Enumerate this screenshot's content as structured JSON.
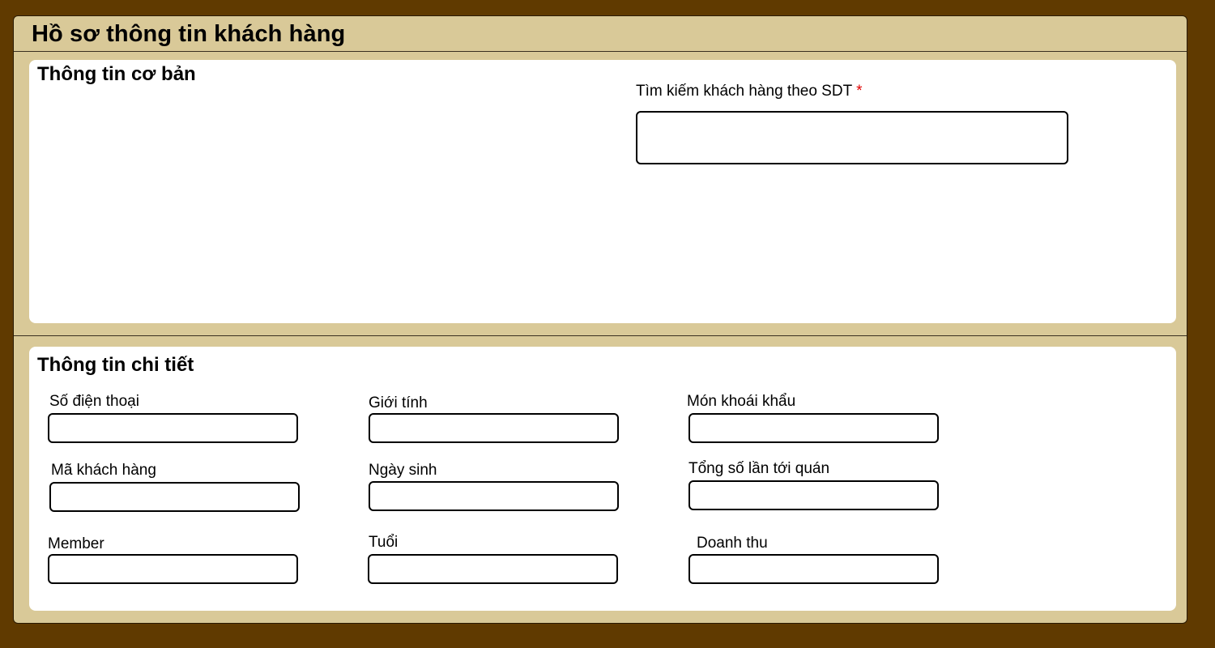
{
  "window": {
    "title": "Hồ sơ thông tin khách hàng"
  },
  "basic_info": {
    "title": "Thông tin cơ bản",
    "search": {
      "label": "Tìm kiếm khách hàng theo SDT",
      "required_mark": "*",
      "value": "",
      "placeholder": ""
    }
  },
  "detail_info": {
    "title": "Thông tin chi tiết",
    "fields": {
      "phone": {
        "label": "Số điện thoại",
        "value": ""
      },
      "gender": {
        "label": "Giới tính",
        "value": ""
      },
      "favorite_dish": {
        "label": "Món khoái khẩu",
        "value": ""
      },
      "customer_code": {
        "label": "Mã khách hàng",
        "value": ""
      },
      "birthday": {
        "label": "Ngày sinh",
        "value": ""
      },
      "visit_count": {
        "label": "Tổng số lần tới quán",
        "value": ""
      },
      "member": {
        "label": "Member",
        "value": ""
      },
      "age": {
        "label": "Tuổi",
        "value": ""
      },
      "revenue": {
        "label": "Doanh thu",
        "value": ""
      }
    }
  },
  "colors": {
    "background": "#603a00",
    "window": "#d9c998",
    "panel": "#ffffff",
    "required": "#e00000"
  }
}
